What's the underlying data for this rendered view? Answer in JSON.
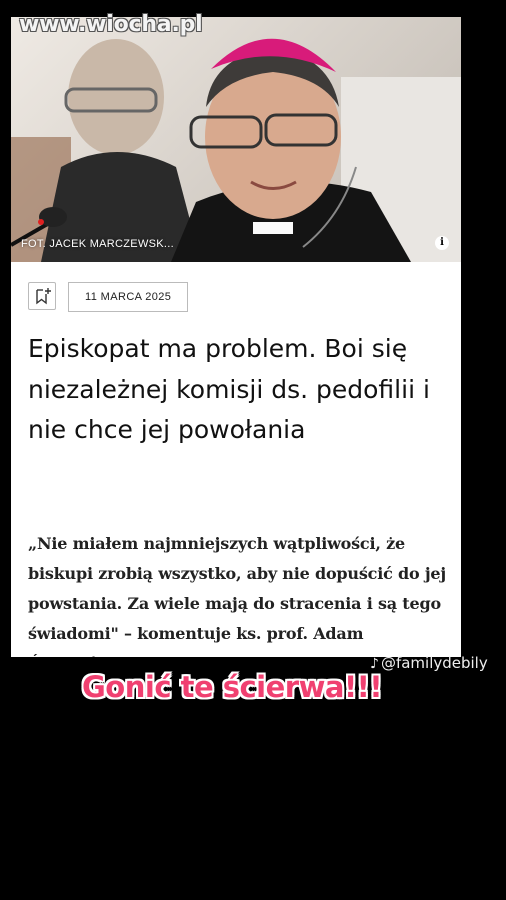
{
  "watermark": "www.wiocha.pl",
  "article": {
    "photo_credit": "FOT. JACEK MARCZEWSK...",
    "info_icon": "i",
    "date": "11 MARCA 2025",
    "headline": "Episkopat ma problem. Boi się niezależnej komisji ds. pedofilii i nie chce jej powołania",
    "lead": "„Nie miałem najmniejszych wątpliwości, że biskupi zrobią wszystko, aby nie dopuścić do jej powstania. Za wiele mają do stracenia i są tego świadomi\" – komentuje ks. prof. Adam Świeżyński z UKSW"
  },
  "overlay": {
    "handle": "@familydebily",
    "caption": "Gonić te ścierwa!!!"
  },
  "colors": {
    "background": "#000000",
    "card": "#ffffff",
    "caption": "#f04070",
    "zucchetto": "#d81b7a"
  }
}
